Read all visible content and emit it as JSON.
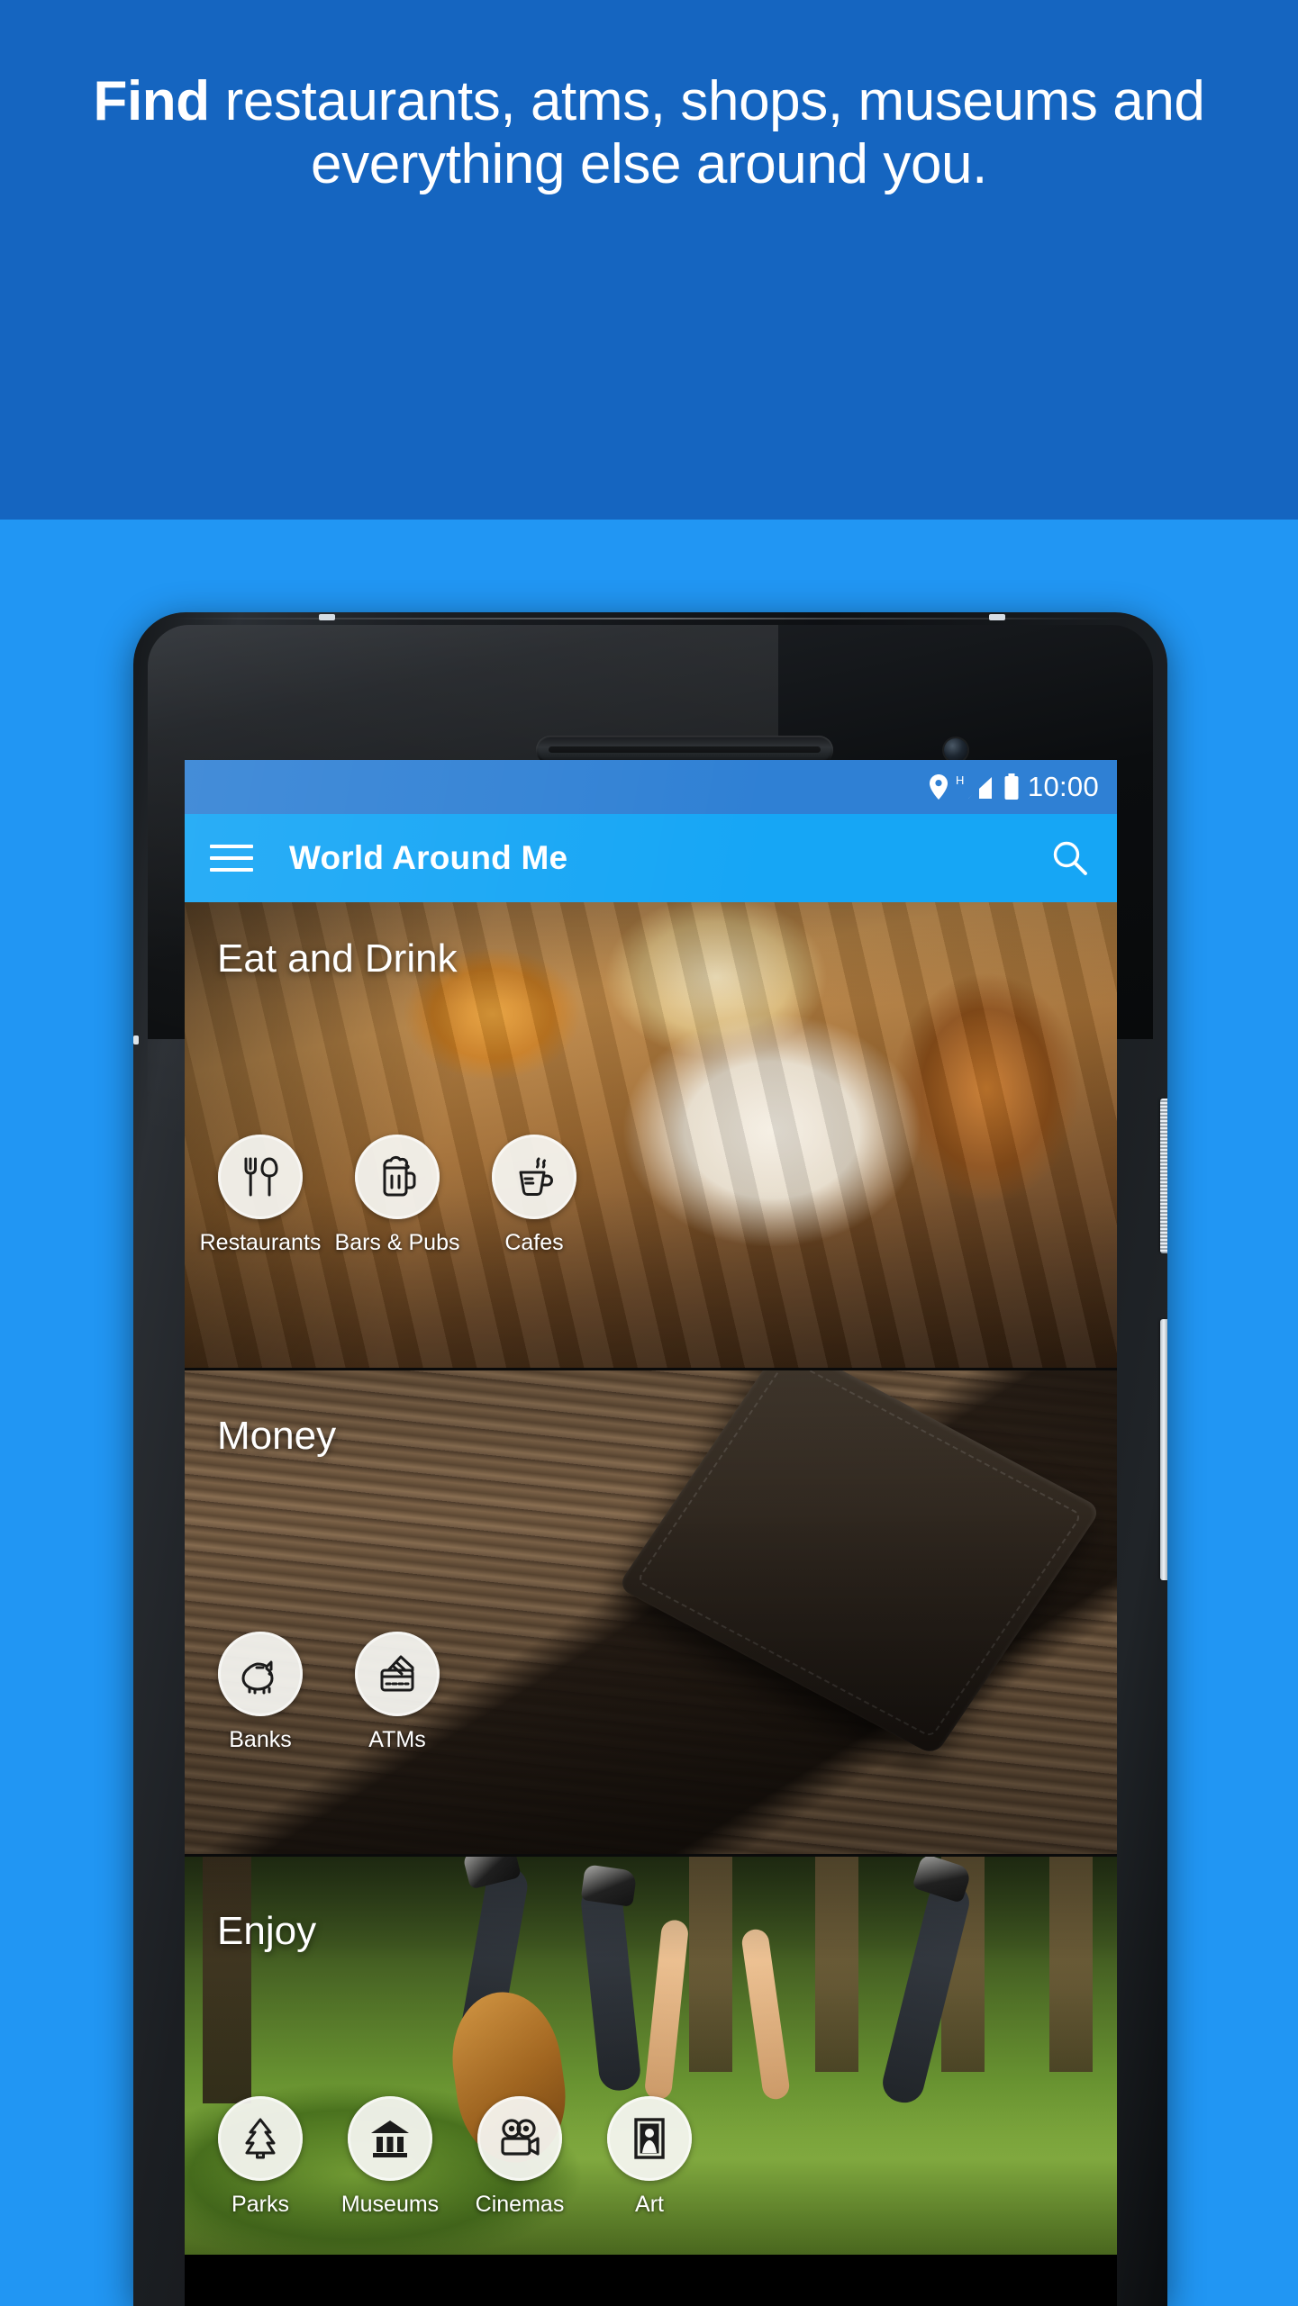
{
  "promo": {
    "headline_lead": "Find",
    "headline_rest": " restaurants, atms, shops, museums and everything else around you.",
    "band_color": "#1565C0",
    "page_bg_color": "#2196F3"
  },
  "device": {
    "hardware": {
      "speaker_grille": "speaker-grille",
      "front_camera": "front-camera",
      "power_button": "power-button",
      "volume_rocker": "volume-rocker"
    }
  },
  "status_bar": {
    "time": "10:00",
    "bg_color": "#2F80D4",
    "icons": [
      {
        "name": "location-pin-icon"
      },
      {
        "name": "signal-h-icon",
        "label": "H"
      },
      {
        "name": "battery-full-icon"
      }
    ]
  },
  "app_bar": {
    "title": "World Around Me",
    "bg_color": "#16A6F5",
    "menu_icon": "hamburger-menu-icon",
    "search_icon": "search-icon"
  },
  "sections": [
    {
      "id": "eat",
      "title": "Eat and Drink",
      "photo": "coffee-pastries-on-wooden-table",
      "tiles": [
        {
          "label": "Restaurants",
          "icon": "fork-and-spoon-icon"
        },
        {
          "label": "Bars & Pubs",
          "icon": "beer-mug-icon"
        },
        {
          "label": "Cafes",
          "icon": "coffee-cup-icon"
        }
      ]
    },
    {
      "id": "money",
      "title": "Money",
      "photo": "leather-wallet-on-wood",
      "tiles": [
        {
          "label": "Banks",
          "icon": "piggy-bank-icon"
        },
        {
          "label": "ATMs",
          "icon": "credit-card-icon"
        }
      ]
    },
    {
      "id": "enjoy",
      "title": "Enjoy",
      "photo": "friends-lying-in-grass-with-guitar",
      "tiles": [
        {
          "label": "Parks",
          "icon": "tree-icon"
        },
        {
          "label": "Museums",
          "icon": "museum-building-icon"
        },
        {
          "label": "Cinemas",
          "icon": "movie-camera-icon"
        },
        {
          "label": "Art",
          "icon": "framed-painting-icon"
        }
      ]
    }
  ]
}
